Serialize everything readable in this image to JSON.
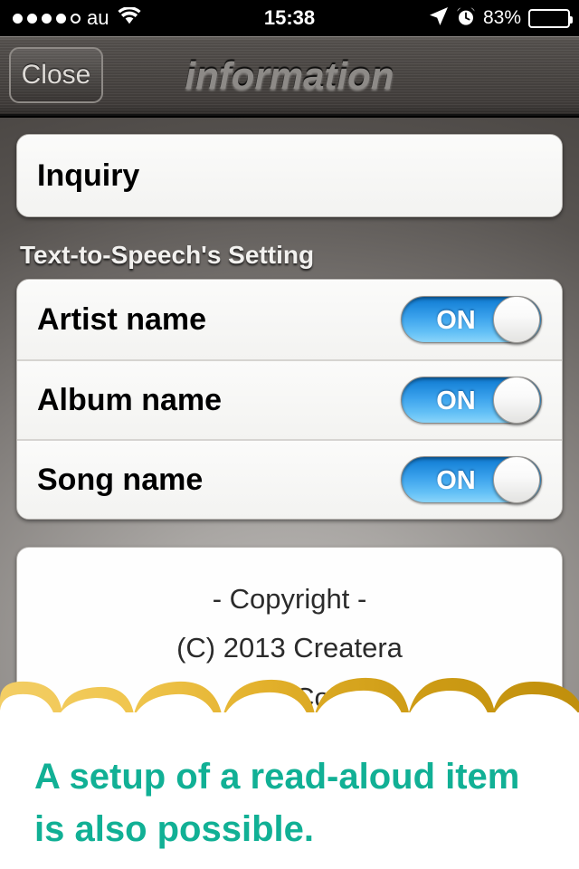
{
  "status_bar": {
    "carrier": "au",
    "signal_dots_filled": 4,
    "signal_dots_total": 5,
    "wifi_icon": "wifi-icon",
    "time": "15:38",
    "location_icon": "location-arrow-icon",
    "alarm_icon": "alarm-clock-icon",
    "battery_percent": "83%",
    "battery_level": 83
  },
  "nav_bar": {
    "close_label": "Close",
    "title": "information"
  },
  "inquiry": {
    "label": "Inquiry"
  },
  "tts_section": {
    "header": "Text-to-Speech's Setting",
    "rows": [
      {
        "label": "Artist name",
        "switch_value": "ON"
      },
      {
        "label": "Album name",
        "switch_value": "ON"
      },
      {
        "label": "Song name",
        "switch_value": "ON"
      }
    ]
  },
  "copyright": {
    "title": "- Copyright -",
    "line1": "(C) 2013 Createra",
    "line2": "Inc. Co."
  },
  "overlay": {
    "caption_line1": "A setup of a read-aloud item",
    "caption_line2": "is also possible.",
    "caption_color": "#11b095",
    "scallop_color_left": "#f3ce66",
    "scallop_color_right": "#c49310"
  },
  "colors": {
    "switch_on_blue": "#2f9ce8",
    "nav_bar_dark": "#4b4744",
    "background_center": "#c2bfbd",
    "background_edge": "#46423f"
  }
}
